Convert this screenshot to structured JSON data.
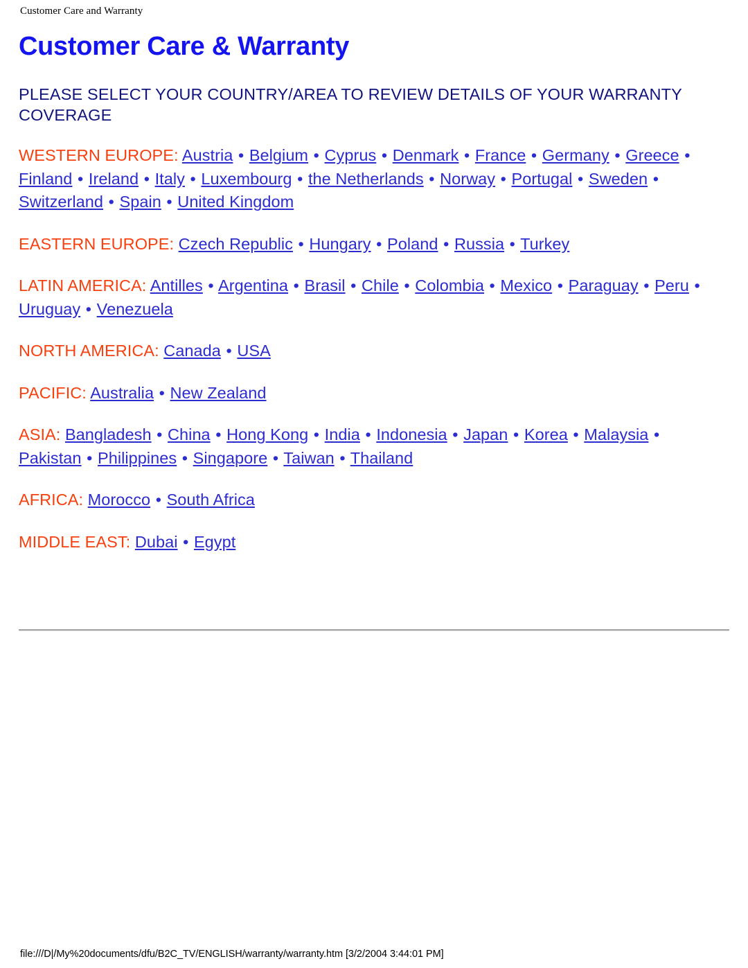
{
  "page": {
    "running_header": "Customer Care and Warranty",
    "title": "Customer Care & Warranty",
    "subtitle": "PLEASE SELECT YOUR COUNTRY/AREA TO REVIEW DETAILS OF YOUR WARRANTY COVERAGE",
    "footer": "file:///D|/My%20documents/dfu/B2C_TV/ENGLISH/warranty/warranty.htm [3/2/2004 3:44:01 PM]",
    "separator": "•"
  },
  "colors": {
    "title_blue": "#1414f0",
    "subtitle_navy": "#11137e",
    "region_label_orange": "#f8400f",
    "link_blue": "#2c2ccf",
    "rule_gray": "#a3a3a3",
    "background": "#ffffff",
    "header_footer_text": "#000000"
  },
  "regions": [
    {
      "id": "western-europe",
      "label": "WESTERN EUROPE:",
      "countries": [
        "Austria",
        "Belgium",
        "Cyprus",
        "Denmark",
        "France",
        "Germany",
        "Greece",
        "Finland",
        "Ireland",
        "Italy",
        "Luxembourg",
        "the Netherlands",
        "Norway",
        "Portugal",
        "Sweden",
        "Switzerland",
        "Spain",
        "United Kingdom"
      ]
    },
    {
      "id": "eastern-europe",
      "label": "EASTERN EUROPE:",
      "countries": [
        "Czech Republic",
        "Hungary",
        "Poland",
        "Russia",
        "Turkey"
      ]
    },
    {
      "id": "latin-america",
      "label": "LATIN AMERICA:",
      "countries": [
        "Antilles",
        "Argentina",
        "Brasil",
        "Chile",
        "Colombia",
        "Mexico",
        "Paraguay",
        "Peru",
        "Uruguay",
        "Venezuela"
      ]
    },
    {
      "id": "north-america",
      "label": "NORTH AMERICA:",
      "countries": [
        "Canada",
        "USA"
      ]
    },
    {
      "id": "pacific",
      "label": "PACIFIC:",
      "countries": [
        "Australia",
        "New Zealand"
      ]
    },
    {
      "id": "asia",
      "label": "ASIA:",
      "countries": [
        "Bangladesh",
        "China",
        "Hong Kong",
        "India",
        "Indonesia",
        "Japan",
        "Korea",
        "Malaysia",
        "Pakistan",
        "Philippines",
        "Singapore",
        "Taiwan",
        "Thailand"
      ]
    },
    {
      "id": "africa",
      "label": "AFRICA:",
      "countries": [
        "Morocco",
        "South Africa"
      ]
    },
    {
      "id": "middle-east",
      "label": "MIDDLE EAST:",
      "countries": [
        "Dubai",
        "Egypt"
      ]
    }
  ]
}
